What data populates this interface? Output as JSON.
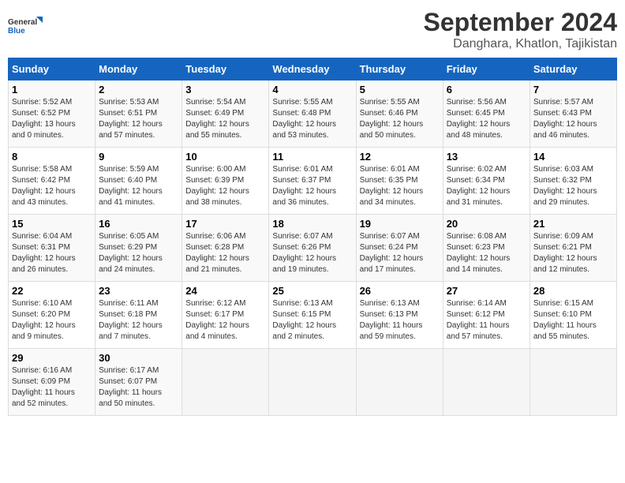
{
  "logo": {
    "line1": "General",
    "line2": "Blue"
  },
  "title": "September 2024",
  "subtitle": "Danghara, Khatlon, Tajikistan",
  "days_header": [
    "Sunday",
    "Monday",
    "Tuesday",
    "Wednesday",
    "Thursday",
    "Friday",
    "Saturday"
  ],
  "weeks": [
    [
      {
        "day": "1",
        "info": "Sunrise: 5:52 AM\nSunset: 6:52 PM\nDaylight: 13 hours\nand 0 minutes."
      },
      {
        "day": "2",
        "info": "Sunrise: 5:53 AM\nSunset: 6:51 PM\nDaylight: 12 hours\nand 57 minutes."
      },
      {
        "day": "3",
        "info": "Sunrise: 5:54 AM\nSunset: 6:49 PM\nDaylight: 12 hours\nand 55 minutes."
      },
      {
        "day": "4",
        "info": "Sunrise: 5:55 AM\nSunset: 6:48 PM\nDaylight: 12 hours\nand 53 minutes."
      },
      {
        "day": "5",
        "info": "Sunrise: 5:55 AM\nSunset: 6:46 PM\nDaylight: 12 hours\nand 50 minutes."
      },
      {
        "day": "6",
        "info": "Sunrise: 5:56 AM\nSunset: 6:45 PM\nDaylight: 12 hours\nand 48 minutes."
      },
      {
        "day": "7",
        "info": "Sunrise: 5:57 AM\nSunset: 6:43 PM\nDaylight: 12 hours\nand 46 minutes."
      }
    ],
    [
      {
        "day": "8",
        "info": "Sunrise: 5:58 AM\nSunset: 6:42 PM\nDaylight: 12 hours\nand 43 minutes."
      },
      {
        "day": "9",
        "info": "Sunrise: 5:59 AM\nSunset: 6:40 PM\nDaylight: 12 hours\nand 41 minutes."
      },
      {
        "day": "10",
        "info": "Sunrise: 6:00 AM\nSunset: 6:39 PM\nDaylight: 12 hours\nand 38 minutes."
      },
      {
        "day": "11",
        "info": "Sunrise: 6:01 AM\nSunset: 6:37 PM\nDaylight: 12 hours\nand 36 minutes."
      },
      {
        "day": "12",
        "info": "Sunrise: 6:01 AM\nSunset: 6:35 PM\nDaylight: 12 hours\nand 34 minutes."
      },
      {
        "day": "13",
        "info": "Sunrise: 6:02 AM\nSunset: 6:34 PM\nDaylight: 12 hours\nand 31 minutes."
      },
      {
        "day": "14",
        "info": "Sunrise: 6:03 AM\nSunset: 6:32 PM\nDaylight: 12 hours\nand 29 minutes."
      }
    ],
    [
      {
        "day": "15",
        "info": "Sunrise: 6:04 AM\nSunset: 6:31 PM\nDaylight: 12 hours\nand 26 minutes."
      },
      {
        "day": "16",
        "info": "Sunrise: 6:05 AM\nSunset: 6:29 PM\nDaylight: 12 hours\nand 24 minutes."
      },
      {
        "day": "17",
        "info": "Sunrise: 6:06 AM\nSunset: 6:28 PM\nDaylight: 12 hours\nand 21 minutes."
      },
      {
        "day": "18",
        "info": "Sunrise: 6:07 AM\nSunset: 6:26 PM\nDaylight: 12 hours\nand 19 minutes."
      },
      {
        "day": "19",
        "info": "Sunrise: 6:07 AM\nSunset: 6:24 PM\nDaylight: 12 hours\nand 17 minutes."
      },
      {
        "day": "20",
        "info": "Sunrise: 6:08 AM\nSunset: 6:23 PM\nDaylight: 12 hours\nand 14 minutes."
      },
      {
        "day": "21",
        "info": "Sunrise: 6:09 AM\nSunset: 6:21 PM\nDaylight: 12 hours\nand 12 minutes."
      }
    ],
    [
      {
        "day": "22",
        "info": "Sunrise: 6:10 AM\nSunset: 6:20 PM\nDaylight: 12 hours\nand 9 minutes."
      },
      {
        "day": "23",
        "info": "Sunrise: 6:11 AM\nSunset: 6:18 PM\nDaylight: 12 hours\nand 7 minutes."
      },
      {
        "day": "24",
        "info": "Sunrise: 6:12 AM\nSunset: 6:17 PM\nDaylight: 12 hours\nand 4 minutes."
      },
      {
        "day": "25",
        "info": "Sunrise: 6:13 AM\nSunset: 6:15 PM\nDaylight: 12 hours\nand 2 minutes."
      },
      {
        "day": "26",
        "info": "Sunrise: 6:13 AM\nSunset: 6:13 PM\nDaylight: 11 hours\nand 59 minutes."
      },
      {
        "day": "27",
        "info": "Sunrise: 6:14 AM\nSunset: 6:12 PM\nDaylight: 11 hours\nand 57 minutes."
      },
      {
        "day": "28",
        "info": "Sunrise: 6:15 AM\nSunset: 6:10 PM\nDaylight: 11 hours\nand 55 minutes."
      }
    ],
    [
      {
        "day": "29",
        "info": "Sunrise: 6:16 AM\nSunset: 6:09 PM\nDaylight: 11 hours\nand 52 minutes."
      },
      {
        "day": "30",
        "info": "Sunrise: 6:17 AM\nSunset: 6:07 PM\nDaylight: 11 hours\nand 50 minutes."
      },
      {
        "day": "",
        "info": ""
      },
      {
        "day": "",
        "info": ""
      },
      {
        "day": "",
        "info": ""
      },
      {
        "day": "",
        "info": ""
      },
      {
        "day": "",
        "info": ""
      }
    ]
  ]
}
